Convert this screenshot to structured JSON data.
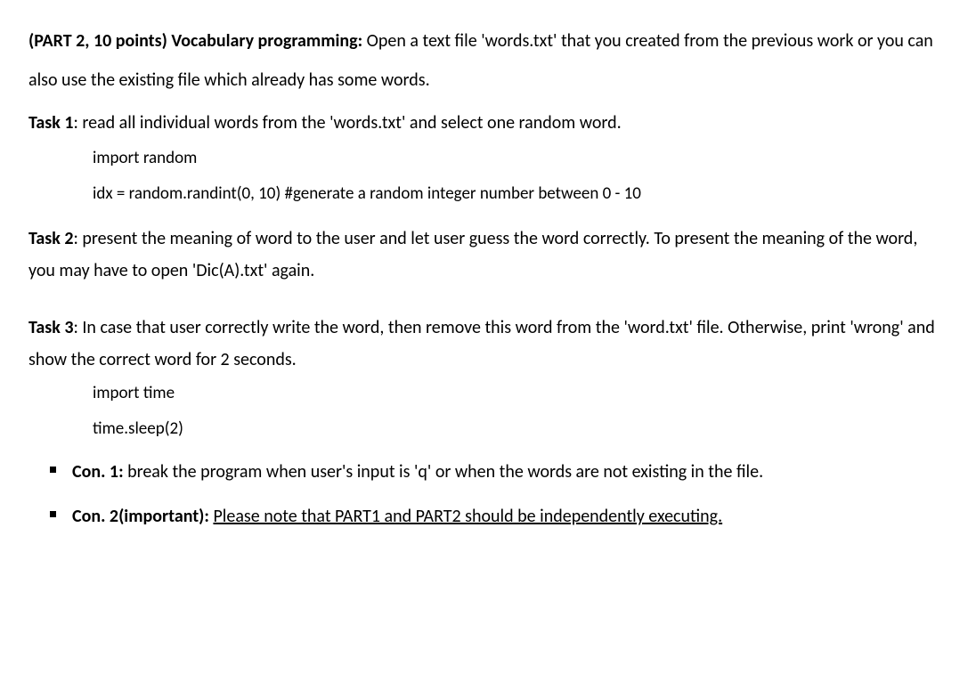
{
  "header": {
    "prefix": "(PART 2, 10 points) Vocabulary programming:",
    "text": " Open a text file 'words.txt' that you created from the previous work or you can also use the existing file which already has some words."
  },
  "task1": {
    "label": "Task 1",
    "text": ": read all individual words from the 'words.txt' and select one random word.",
    "code1": "import random",
    "code2": "idx = random.randint(0, 10) #generate a random integer number between 0 - 10"
  },
  "task2": {
    "label": "Task 2",
    "text": ": present the meaning of word to the user and let user guess the word correctly. To present the meaning of the word, you may have to open 'Dic(A).txt' again."
  },
  "task3": {
    "label": "Task 3",
    "text": ": In case that user correctly write the word, then remove this word from the 'word.txt' file. Otherwise, print 'wrong' and show the correct word for 2 seconds.",
    "code1": "import time",
    "code2": "time.sleep(2)"
  },
  "con1": {
    "label": "Con. 1:",
    "text": " break the program when user's input is 'q' or when the words are not existing in the file."
  },
  "con2": {
    "label": "Con. 2(important):",
    "text": "Please note that PART1 and PART2 should be independently executing."
  }
}
